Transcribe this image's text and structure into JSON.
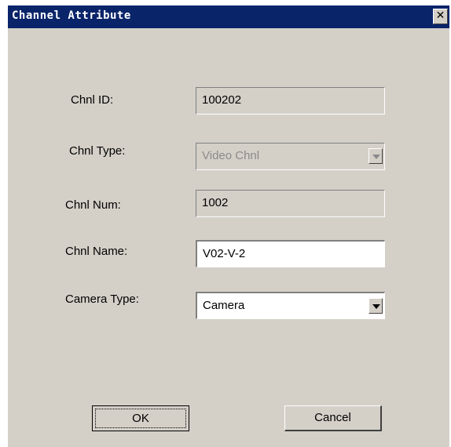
{
  "window": {
    "title": "Channel Attribute",
    "close_glyph": "✕"
  },
  "fields": {
    "chnl_id": {
      "label": "Chnl ID:",
      "value": "100202"
    },
    "chnl_type": {
      "label": "Chnl Type:",
      "value": "Video Chnl"
    },
    "chnl_num": {
      "label": "Chnl Num:",
      "value": "1002"
    },
    "chnl_name": {
      "label": "Chnl Name:",
      "value": "V02-V-2"
    },
    "camera_type": {
      "label": "Camera Type:",
      "value": "Camera"
    }
  },
  "buttons": {
    "ok": "OK",
    "cancel": "Cancel"
  },
  "colors": {
    "titlebar": "#0a246a",
    "dialog_bg": "#d4d0c8"
  }
}
